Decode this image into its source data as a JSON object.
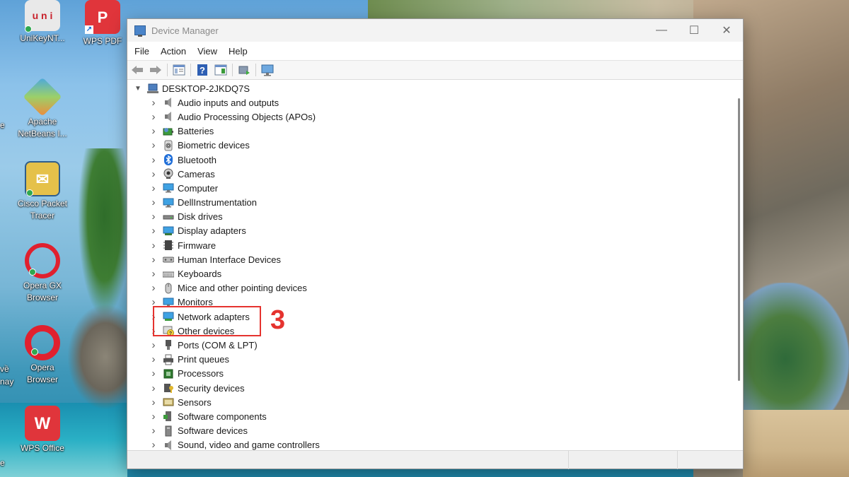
{
  "desktop": {
    "icons": [
      {
        "label": "UniKeyNT...",
        "icon": "unikey-icon"
      },
      {
        "label": "WPS PDF",
        "icon": "wps-pdf-icon"
      },
      {
        "label": "Apache NetBeans I...",
        "icon": "netbeans-icon"
      },
      {
        "label": "Cisco Packet Tracer",
        "icon": "cisco-packet-tracer-icon"
      },
      {
        "label": "Opera GX Browser",
        "icon": "opera-gx-icon"
      },
      {
        "label": "Opera Browser",
        "icon": "opera-icon"
      },
      {
        "label": "WPS Office",
        "icon": "wps-office-icon"
      }
    ],
    "partial_labels": [
      "e",
      "về",
      "nay",
      "e"
    ]
  },
  "window": {
    "title": "Device Manager",
    "controls": {
      "minimize": "—",
      "maximize": "☐",
      "close": "✕"
    }
  },
  "menu": [
    "File",
    "Action",
    "View",
    "Help"
  ],
  "toolbar": {
    "buttons": [
      "back-icon",
      "forward-icon",
      "properties-grid-icon",
      "help-icon",
      "view-pane-icon",
      "update-driver-icon",
      "scan-hardware-icon"
    ]
  },
  "tree": {
    "root": "DESKTOP-2JKDQ7S",
    "categories": [
      {
        "label": "Audio inputs and outputs",
        "icon": "speaker-icon"
      },
      {
        "label": "Audio Processing Objects (APOs)",
        "icon": "speaker-icon"
      },
      {
        "label": "Batteries",
        "icon": "battery-icon"
      },
      {
        "label": "Biometric devices",
        "icon": "fingerprint-icon"
      },
      {
        "label": "Bluetooth",
        "icon": "bluetooth-icon"
      },
      {
        "label": "Cameras",
        "icon": "camera-icon"
      },
      {
        "label": "Computer",
        "icon": "monitor-icon"
      },
      {
        "label": "DellInstrumentation",
        "icon": "monitor-icon"
      },
      {
        "label": "Disk drives",
        "icon": "disk-icon"
      },
      {
        "label": "Display adapters",
        "icon": "display-adapter-icon"
      },
      {
        "label": "Firmware",
        "icon": "firmware-icon"
      },
      {
        "label": "Human Interface Devices",
        "icon": "hid-icon"
      },
      {
        "label": "Keyboards",
        "icon": "keyboard-icon"
      },
      {
        "label": "Mice and other pointing devices",
        "icon": "mouse-icon"
      },
      {
        "label": "Monitors",
        "icon": "monitor-icon"
      },
      {
        "label": "Network adapters",
        "icon": "network-icon"
      },
      {
        "label": "Other devices",
        "icon": "unknown-device-icon"
      },
      {
        "label": "Ports (COM & LPT)",
        "icon": "port-icon"
      },
      {
        "label": "Print queues",
        "icon": "printer-icon"
      },
      {
        "label": "Processors",
        "icon": "processor-icon"
      },
      {
        "label": "Security devices",
        "icon": "security-icon"
      },
      {
        "label": "Sensors",
        "icon": "sensor-icon"
      },
      {
        "label": "Software components",
        "icon": "software-component-icon"
      },
      {
        "label": "Software devices",
        "icon": "software-device-icon"
      },
      {
        "label": "Sound, video and game controllers",
        "icon": "speaker-icon"
      }
    ]
  },
  "annotation": {
    "step": "3",
    "color": "#e5332f"
  }
}
